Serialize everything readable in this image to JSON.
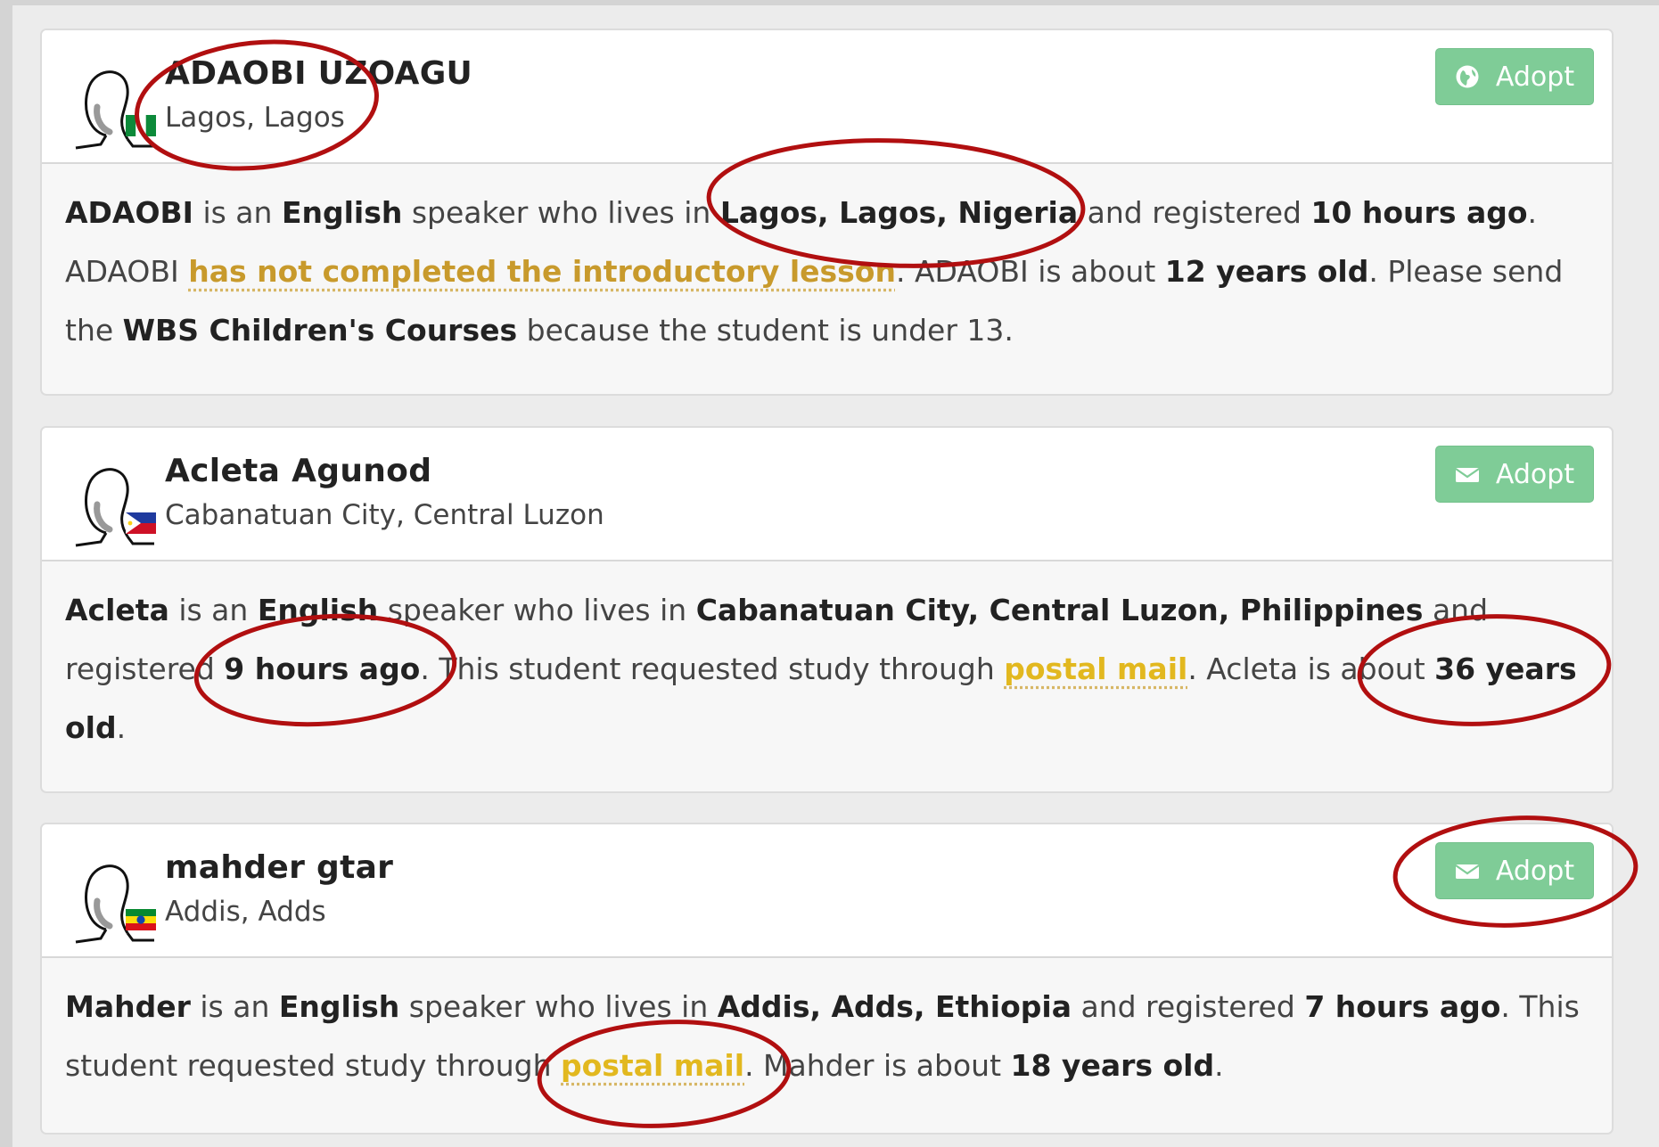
{
  "adopt_label": "Adopt",
  "colors": {
    "adopt_button": "#7fcc97",
    "link_orange": "#c89a2c",
    "link_yellow": "#e2b81f",
    "annotation_red": "#b10f10"
  },
  "students": [
    {
      "name": "ADAOBI UZOAGU",
      "location": "Lagos, Lagos",
      "flag": "nigeria-flag",
      "adopt_icon": "globe-icon",
      "desc": {
        "first_name": "ADAOBI",
        "t1": " is an ",
        "language": "English",
        "t2": " speaker who lives in ",
        "place": "Lagos, Lagos, Nigeria",
        "t3": " and registered ",
        "registered": "10 hours ago",
        "t4": ". ADAOBI ",
        "lesson_link": "has not completed the introductory lesson",
        "t5": ". ADAOBI is about ",
        "age": "12 years old",
        "t6": ". Please send the ",
        "course": "WBS Children's Courses",
        "t7": " because the student is under 13."
      }
    },
    {
      "name": "Acleta Agunod",
      "location": "Cabanatuan City, Central Luzon",
      "flag": "philippines-flag",
      "adopt_icon": "envelope-icon",
      "desc": {
        "first_name": "Acleta",
        "t1": " is an ",
        "language": "English",
        "t2": " speaker who lives in ",
        "place": "Cabanatuan City, Central Luzon, Philippines",
        "t3": " and registered ",
        "registered": "9 hours ago",
        "t4": ". This student requested study through ",
        "mail_link": "postal mail",
        "t5": ". Acleta is about ",
        "age": "36 years old",
        "t6": "."
      }
    },
    {
      "name": "mahder gtar",
      "location": "Addis, Adds",
      "flag": "ethiopia-flag",
      "adopt_icon": "envelope-icon",
      "desc": {
        "first_name": "Mahder",
        "t1": " is an ",
        "language": "English",
        "t2": " speaker who lives in ",
        "place": "Addis, Adds, Ethiopia",
        "t3": " and registered ",
        "registered": "7 hours ago",
        "t4": ". This student requested study through ",
        "mail_link": "postal mail",
        "t5": ". Mahder is about ",
        "age": "18 years old",
        "t6": "."
      }
    }
  ]
}
